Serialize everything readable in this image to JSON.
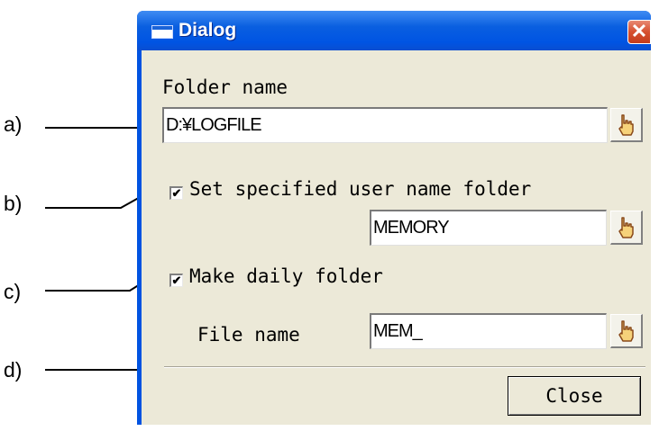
{
  "callouts": [
    "a)",
    "b)",
    "c)",
    "d)"
  ],
  "window": {
    "title": "Dialog",
    "close_glyph": "✕"
  },
  "folder_name": {
    "label": "Folder name",
    "value": "D:¥LOGFILE"
  },
  "user_folder": {
    "checkbox_label": "Set specified user name folder",
    "checked": true,
    "value": "MEMORY"
  },
  "daily_folder": {
    "checkbox_label": "Make daily folder",
    "checked": true
  },
  "file_name": {
    "label": "File name",
    "value": "MEM_"
  },
  "close_button": {
    "label": "Close"
  },
  "check_glyph": "✔",
  "icons": [
    "title-window-icon",
    "close-icon",
    "hand-pointer-icon",
    "checkbox-check-icon"
  ]
}
